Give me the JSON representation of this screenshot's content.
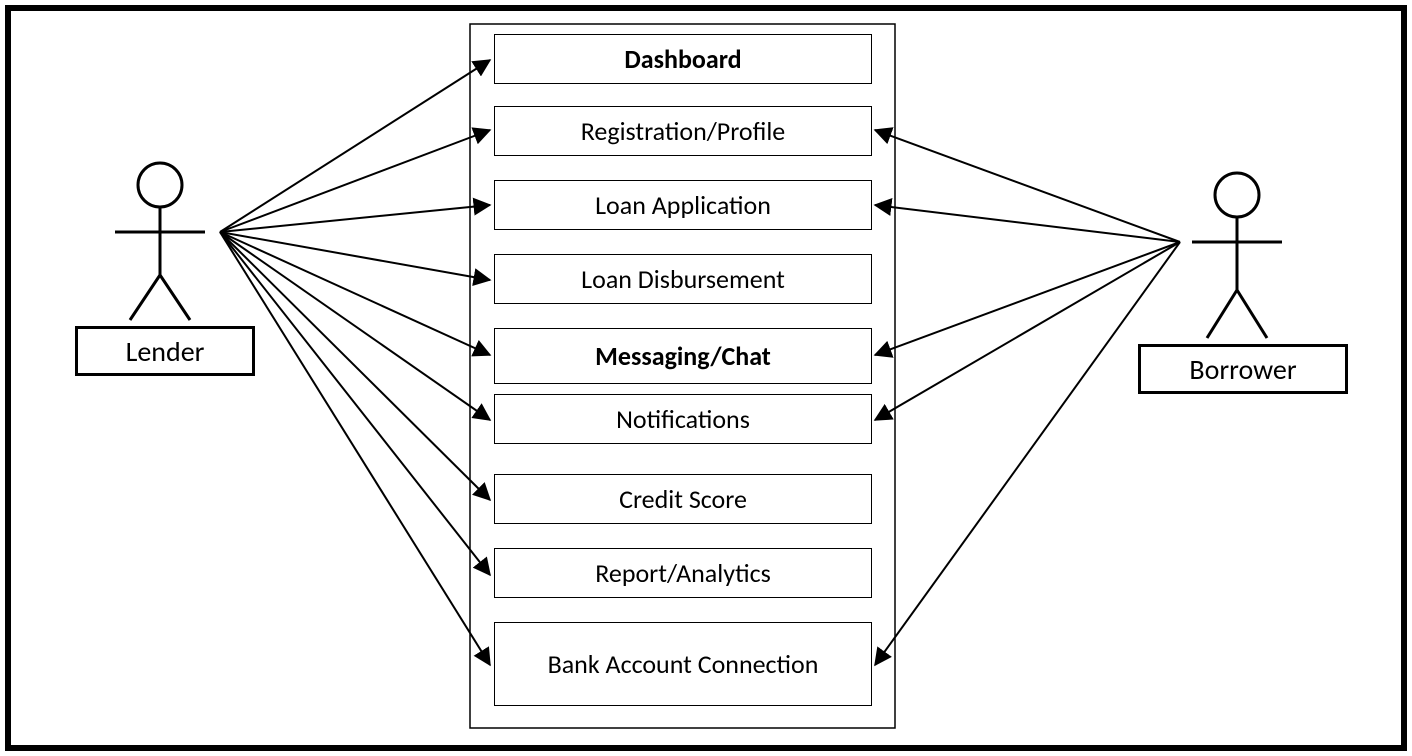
{
  "actors": {
    "left": {
      "label": "Lender"
    },
    "right": {
      "label": "Borrower"
    }
  },
  "usecases": [
    {
      "label": "Dashboard"
    },
    {
      "label": "Registration/Profile"
    },
    {
      "label": "Loan Application"
    },
    {
      "label": "Loan Disbursement"
    },
    {
      "label": "Messaging/Chat"
    },
    {
      "label": "Notifications"
    },
    {
      "label": "Credit Score"
    },
    {
      "label": "Report/Analytics"
    },
    {
      "label": "Bank Account Connection"
    }
  ],
  "chart_data": {
    "type": "use-case-diagram",
    "actors": [
      {
        "name": "Lender",
        "side": "left"
      },
      {
        "name": "Borrower",
        "side": "right"
      }
    ],
    "use_cases": [
      "Dashboard",
      "Registration/Profile",
      "Loan Application",
      "Loan Disbursement",
      "Messaging/Chat",
      "Notifications",
      "Credit Score",
      "Report/Analytics",
      "Bank Account Connection"
    ],
    "associations": [
      {
        "actor": "Lender",
        "use_case": "Dashboard"
      },
      {
        "actor": "Lender",
        "use_case": "Registration/Profile"
      },
      {
        "actor": "Lender",
        "use_case": "Loan Application"
      },
      {
        "actor": "Lender",
        "use_case": "Loan Disbursement"
      },
      {
        "actor": "Lender",
        "use_case": "Messaging/Chat"
      },
      {
        "actor": "Lender",
        "use_case": "Notifications"
      },
      {
        "actor": "Lender",
        "use_case": "Credit Score"
      },
      {
        "actor": "Lender",
        "use_case": "Report/Analytics"
      },
      {
        "actor": "Lender",
        "use_case": "Bank Account Connection"
      },
      {
        "actor": "Borrower",
        "use_case": "Registration/Profile"
      },
      {
        "actor": "Borrower",
        "use_case": "Loan Application"
      },
      {
        "actor": "Borrower",
        "use_case": "Messaging/Chat"
      },
      {
        "actor": "Borrower",
        "use_case": "Notifications"
      },
      {
        "actor": "Borrower",
        "use_case": "Bank Account Connection"
      }
    ]
  }
}
